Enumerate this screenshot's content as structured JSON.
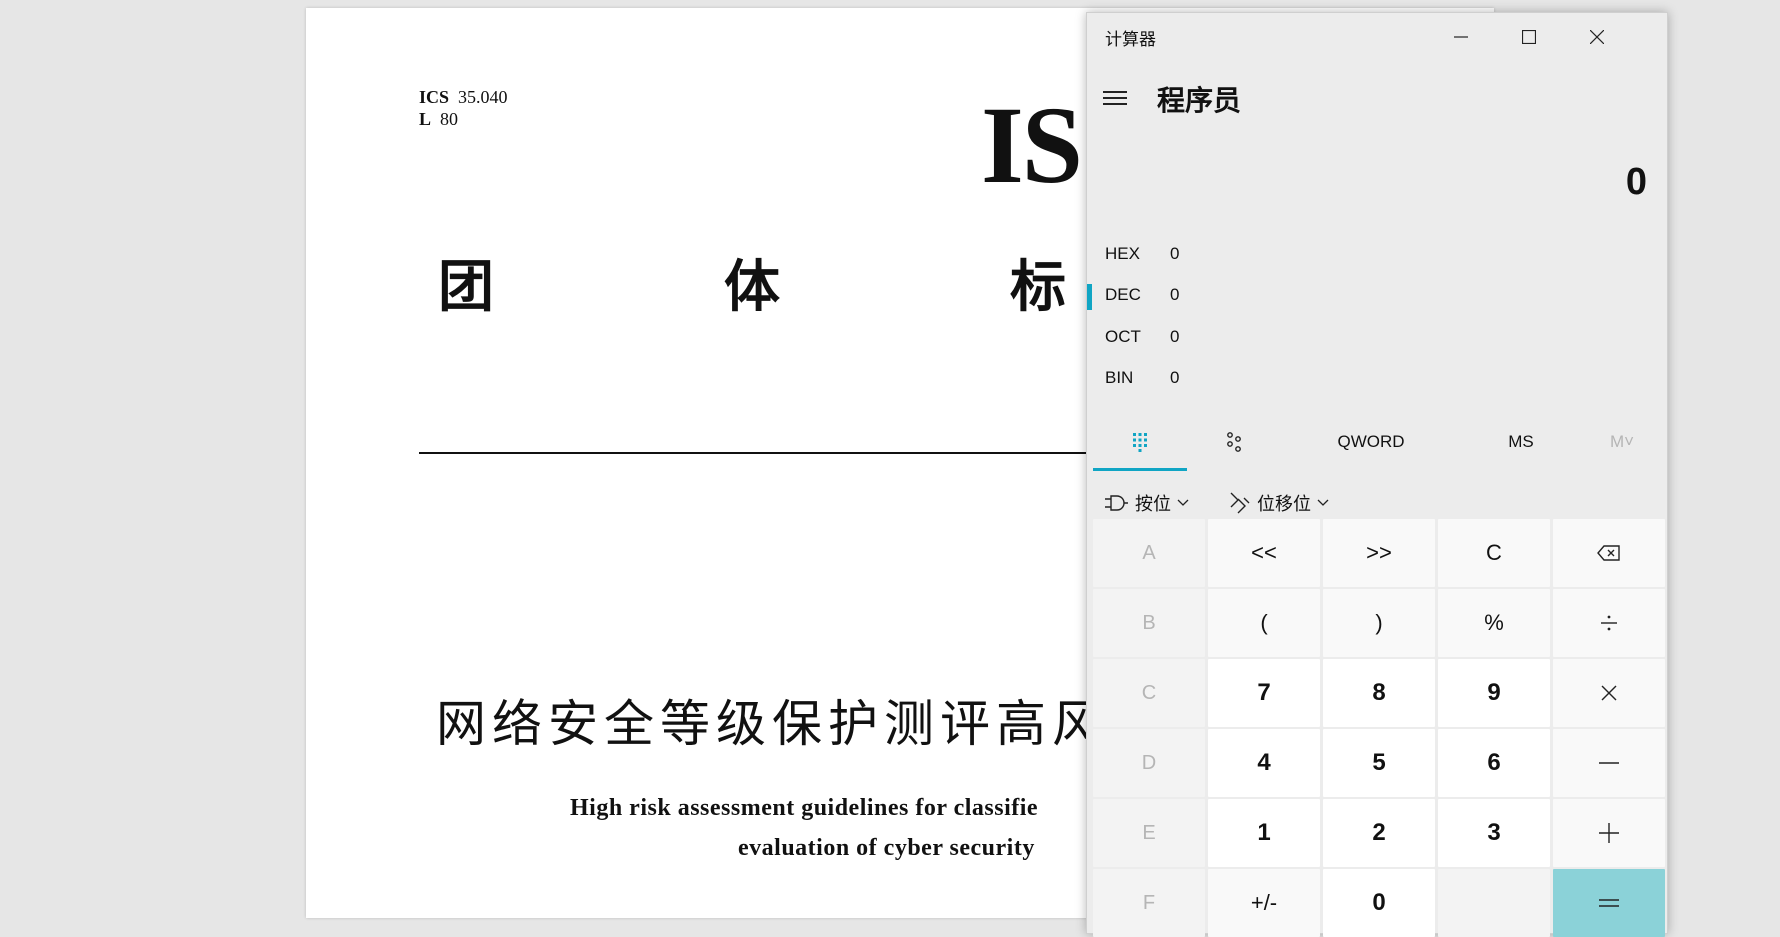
{
  "document": {
    "ics_label": "ICS",
    "ics_value": "35.040",
    "class_label": "L",
    "class_value": "80",
    "code_partial": "IS",
    "group_standard_chars": [
      "团",
      "体",
      "标"
    ],
    "title_cn_visible": "网络安全等级保护测评高风",
    "title_en_line1": "High risk assessment guidelines for classifie",
    "title_en_line2": "evaluation of cyber security"
  },
  "calculator": {
    "window_title": "计算器",
    "mode_title": "程序员",
    "display_value": "0",
    "radix": [
      {
        "name": "HEX",
        "value": "0",
        "selected": false
      },
      {
        "name": "DEC",
        "value": "0",
        "selected": true
      },
      {
        "name": "OCT",
        "value": "0",
        "selected": false
      },
      {
        "name": "BIN",
        "value": "0",
        "selected": false
      }
    ],
    "tabs": {
      "full_keypad_icon": "full-keypad-icon",
      "bit_toggle_icon": "bit-toggle-keypad-icon",
      "word_size": "QWORD",
      "memory_store": "MS",
      "memory_list": "M˅"
    },
    "bitwise_label": "按位",
    "bitshift_label": "位移位",
    "accent_color": "#10a5c4",
    "equals_color": "#8bd2d8",
    "keys": [
      [
        "A",
        "<<",
        ">>",
        "C",
        "backspace-icon"
      ],
      [
        "B",
        "(",
        ")",
        "%",
        "divide-icon"
      ],
      [
        "C",
        "7",
        "8",
        "9",
        "multiply-icon"
      ],
      [
        "D",
        "4",
        "5",
        "6",
        "minus-icon"
      ],
      [
        "E",
        "1",
        "2",
        "3",
        "plus-icon"
      ],
      [
        "F",
        "+/-",
        "0",
        "",
        "equals-icon"
      ]
    ]
  }
}
